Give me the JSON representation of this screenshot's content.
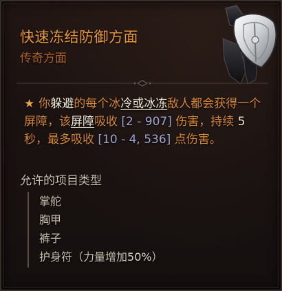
{
  "tooltip": {
    "title": "快速冻结防御方面",
    "subtitle": "传奇方面",
    "item_art_icon": "ornate-shield-icon",
    "affix": {
      "bullet_icon": "star-icon",
      "bullet": "★",
      "seg1": "你",
      "seg2": "躲避",
      "seg3": "的每个冰",
      "seg4": "冷或冰冻",
      "seg5": "敌人都会获得一个屏障，该",
      "seg6": "屏障",
      "seg7": "吸收 ",
      "range1": "[2 - 907]",
      "seg8": " 伤害，持续 ",
      "seg9": "5",
      "seg10": " 秒，最多吸收 ",
      "range2": "[10 - 4, 536]",
      "seg11": " 点伤害。"
    },
    "allowed": {
      "heading": "允许的项目类型",
      "items": [
        "掌舵",
        "胸甲",
        "裤子"
      ],
      "amulet_label": "护身符（力量增加",
      "amulet_pct": "50%",
      "amulet_close": "）"
    }
  },
  "colors": {
    "title": "#e6973e",
    "subtitle": "#b0642c",
    "affix_text": "#d4873a",
    "affix_range": "#a0a4ce",
    "body_text": "#c9bfb0"
  }
}
